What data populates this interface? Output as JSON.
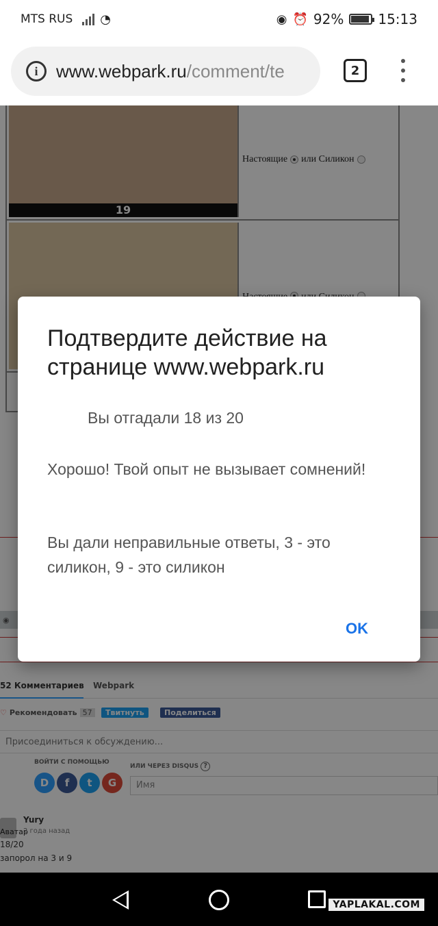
{
  "status_bar": {
    "carrier": "MTS RUS",
    "battery": "92%",
    "battery_level": 0.92,
    "time": "15:13"
  },
  "browser": {
    "url_host": "www.webpark.ru",
    "url_rest": "/comment/te",
    "tab_count": "2"
  },
  "quiz": {
    "rows": [
      {
        "number": "19",
        "option_a": "Настоящие",
        "option_b": "или Силикон"
      },
      {
        "number": "",
        "option_a": "Настоящие",
        "option_b": "или Силикон"
      }
    ]
  },
  "dialog": {
    "title": "Подтвердите действие на странице www.webpark.ru",
    "score": "Вы отгадали 18 из 20",
    "message_1": "Хорошо! Твой опыт не вызывает сомнений!",
    "message_2": "Вы дали неправильные ответы, 3 - это силикон, 9 - это силикон",
    "ok_label": "OK"
  },
  "disqus": {
    "tabs": [
      "52 Комментариев",
      "Webpark"
    ],
    "recommend_label": "Рекомендовать",
    "recommend_count": "57",
    "tweet_label": "Твитнуть",
    "share_label": "Поделиться",
    "join_placeholder": "Присоединиться к обсуждению...",
    "login_with": "ВОЙТИ С ПОМОЩЬЮ",
    "or_disqus": "ИЛИ ЧЕРЕЗ DISQUS",
    "name_placeholder": "Имя",
    "login_icons": [
      {
        "letter": "D",
        "color": "#2e9fff"
      },
      {
        "letter": "f",
        "color": "#3b5998"
      },
      {
        "letter": "t",
        "color": "#1da1f2"
      },
      {
        "letter": "G",
        "color": "#dd4b39"
      }
    ]
  },
  "comment": {
    "avatar_alt": "Аватар",
    "author": "Yury",
    "time": "2 года назад",
    "line1": "18/20",
    "line2": "запорол на 3 и 9"
  },
  "watermark": "YAPLAKAL.COM"
}
